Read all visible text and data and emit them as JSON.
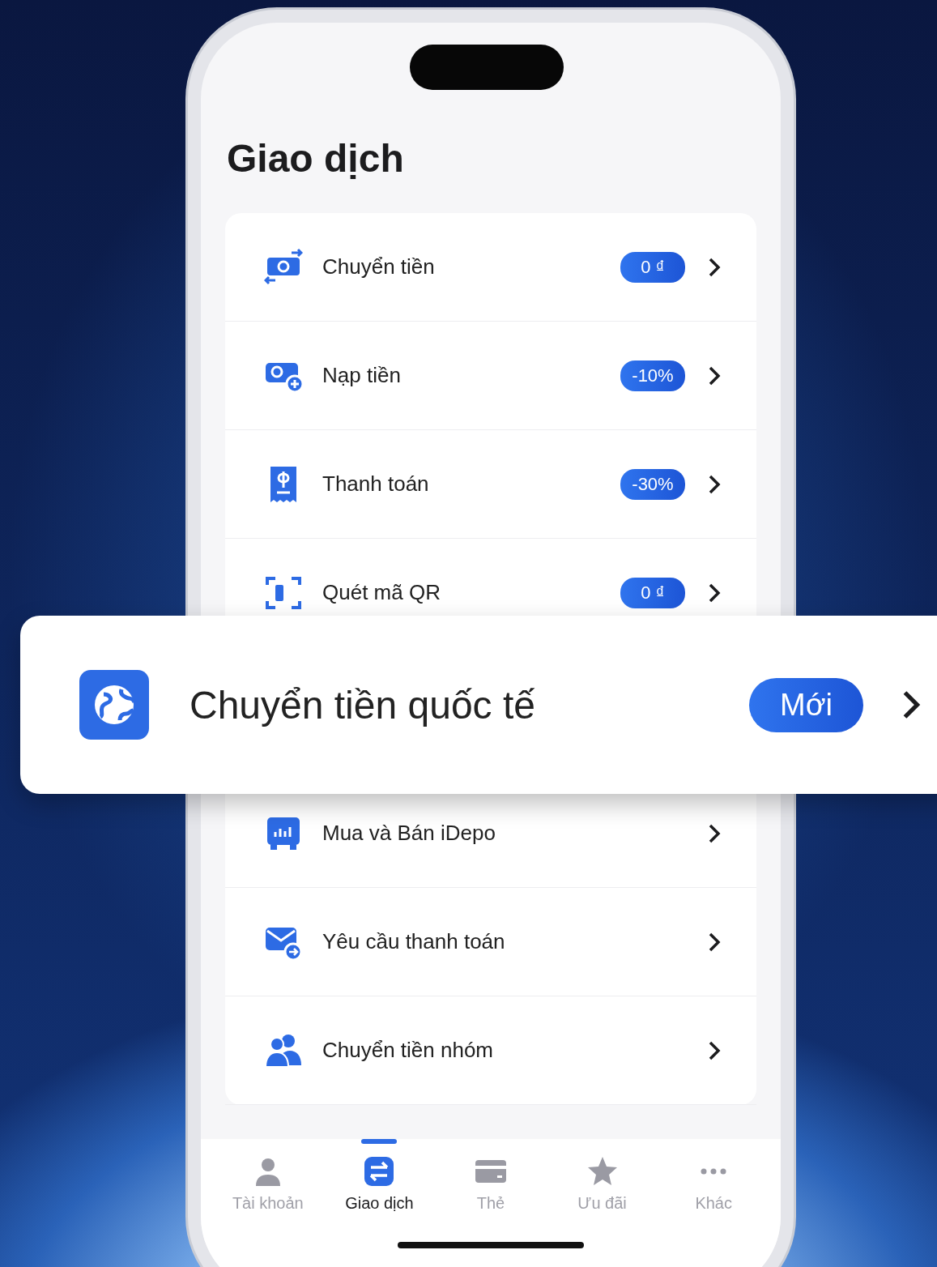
{
  "screen": {
    "title": "Giao dịch",
    "items": [
      {
        "label": "Chuyển tiền",
        "badge": "0 ₫"
      },
      {
        "label": "Nạp tiền",
        "badge": "-10%"
      },
      {
        "label": "Thanh toán",
        "badge": "-30%"
      },
      {
        "label": "Quét mã QR",
        "badge": "0 ₫"
      },
      {
        "label": "Mua và Bán iDepo"
      },
      {
        "label": "Yêu cầu thanh toán"
      },
      {
        "label": "Chuyển tiền nhóm"
      }
    ],
    "tabs": [
      {
        "label": "Tài khoản",
        "selected": false
      },
      {
        "label": "Giao dịch",
        "selected": true
      },
      {
        "label": "Thẻ",
        "selected": false
      },
      {
        "label": "Ưu đãi",
        "selected": false
      },
      {
        "label": "Khác",
        "selected": false
      }
    ]
  },
  "highlight": {
    "label": "Chuyển tiền quốc tế",
    "badge": "Mới"
  }
}
